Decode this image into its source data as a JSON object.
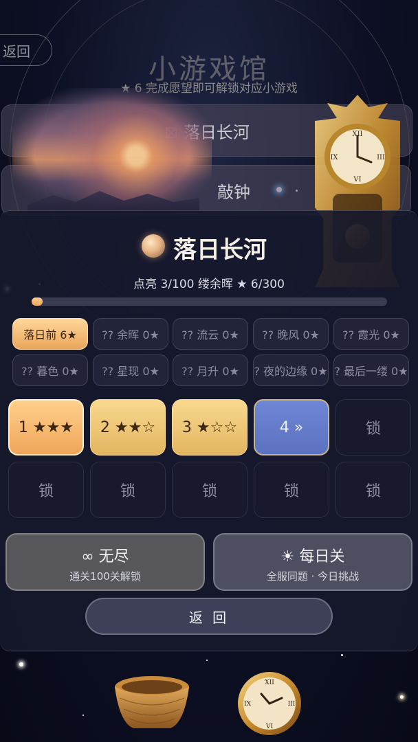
{
  "top_bar": {
    "back_label": "返回"
  },
  "hall": {
    "title": "小游戏馆",
    "subtitle": "★ 6   完成愿望即可解锁对应小游戏",
    "rows": [
      {
        "label": "⊠ 落日长河"
      },
      {
        "label": "敲钟"
      }
    ]
  },
  "panel": {
    "title": "落日长河",
    "progress_text": "点亮 3/100 缕余晖  ★ 6/300",
    "progress_fraction": 0.03,
    "chapters": [
      {
        "label": "落日前 6★",
        "active": true
      },
      {
        "label": "?? 余晖  0★",
        "active": false
      },
      {
        "label": "?? 流云  0★",
        "active": false
      },
      {
        "label": "?? 晚风  0★",
        "active": false
      },
      {
        "label": "?? 霞光  0★",
        "active": false
      },
      {
        "label": "?? 暮色  0★",
        "active": false
      },
      {
        "label": "?? 星现  0★",
        "active": false
      },
      {
        "label": "?? 月升  0★",
        "active": false
      },
      {
        "label": "? 夜的边缘  0★",
        "active": false
      },
      {
        "label": "? 最后一缕  0★",
        "active": false
      }
    ],
    "levels": [
      {
        "label": "1 ★★★",
        "state": "cleared"
      },
      {
        "label": "2 ★★☆",
        "state": "cleared"
      },
      {
        "label": "3 ★☆☆",
        "state": "cleared"
      },
      {
        "label": "4 »",
        "state": "current"
      },
      {
        "label": "锁",
        "state": "locked"
      },
      {
        "label": "锁",
        "state": "locked"
      },
      {
        "label": "锁",
        "state": "locked"
      },
      {
        "label": "锁",
        "state": "locked"
      },
      {
        "label": "锁",
        "state": "locked"
      },
      {
        "label": "锁",
        "state": "locked"
      }
    ],
    "endless": {
      "title": "∞ 无尽",
      "subtitle": "通关100关解锁"
    },
    "daily": {
      "title": "☀ 每日关",
      "subtitle": "全服同题 · 今日挑战"
    },
    "back_label": "返 回"
  },
  "colors": {
    "gold": "#e9a35c",
    "blue": "#6f86d6",
    "panel": "#16182c"
  },
  "icons": {
    "hall_decor": [
      "clock-icon",
      "basket-icon",
      "sunset-image"
    ]
  }
}
